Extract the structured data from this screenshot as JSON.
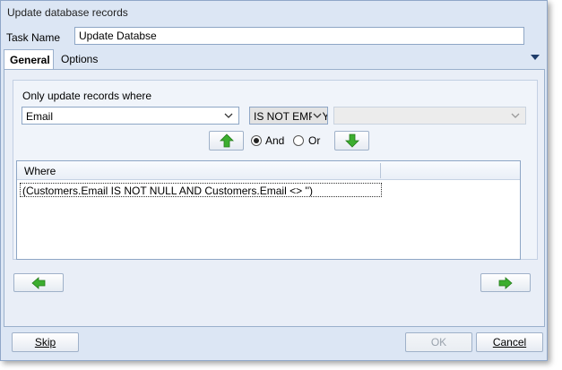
{
  "window": {
    "title": "Update database records"
  },
  "task": {
    "label": "Task Name",
    "value": "Update Databse"
  },
  "tabs": [
    {
      "label": "General"
    },
    {
      "label": "Options"
    }
  ],
  "filter": {
    "heading": "Only update records where",
    "field": "Email",
    "operator": "IS NOT EMPTY",
    "value": "",
    "and_label": "And",
    "or_label": "Or",
    "and_selected": true
  },
  "grid": {
    "columns": [
      "Where",
      ""
    ],
    "rows": [
      "(Customers.Email IS NOT NULL AND Customers.Email <> '')"
    ]
  },
  "footer": {
    "skip": "Skip",
    "ok": "OK",
    "cancel": "Cancel"
  },
  "colors": {
    "arrow_green": "#3cae2f",
    "accent_border": "#8ea6c5"
  }
}
